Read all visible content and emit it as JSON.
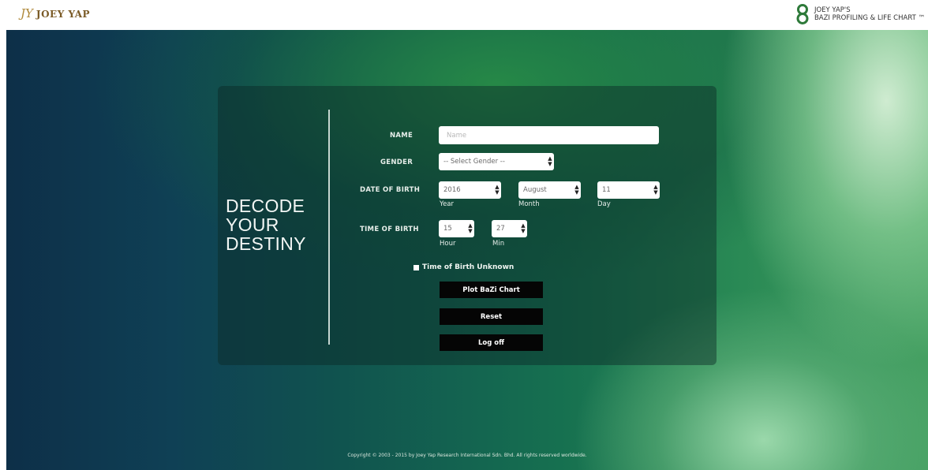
{
  "header": {
    "left_brand": {
      "mark": "JY",
      "text": "JOEY YAP"
    },
    "right_brand": {
      "line1": "JOEY YAP'S",
      "line2": "BAZI PROFILING & LIFE CHART ™"
    }
  },
  "hero": {
    "headline": [
      "DECODE",
      "YOUR",
      "DESTINY"
    ]
  },
  "form": {
    "name_label": "NAME",
    "name_placeholder": "Name",
    "name_value": "",
    "gender_label": "GENDER",
    "gender_value": "-- Select Gender --",
    "dob_label": "DATE OF BIRTH",
    "year_value": "2016",
    "year_caption": "Year",
    "month_value": "August",
    "month_caption": "Month",
    "day_value": "11",
    "day_caption": "Day",
    "tob_label": "TIME OF BIRTH",
    "hour_value": "15",
    "hour_caption": "Hour",
    "min_value": "27",
    "min_caption": "Min",
    "unknown_label": "Time of Birth Unknown",
    "unknown_checked": true
  },
  "buttons": {
    "plot": "Plot BaZi Chart",
    "reset": "Reset",
    "logoff": "Log off"
  },
  "footer": {
    "copyright": "Copyright © 2003 - 2015 by Joey Yap Research International Sdn. Bhd. All rights reserved worldwide."
  },
  "icons": {
    "select_arrow": "updown-arrow-icon",
    "left_logo": "joey-yap-monogram-icon",
    "right_logo": "bazi-logo-icon"
  },
  "colors": {
    "accent_green": "#2a8a55",
    "button_black": "#050505",
    "brand_gold": "#b08a3c"
  }
}
